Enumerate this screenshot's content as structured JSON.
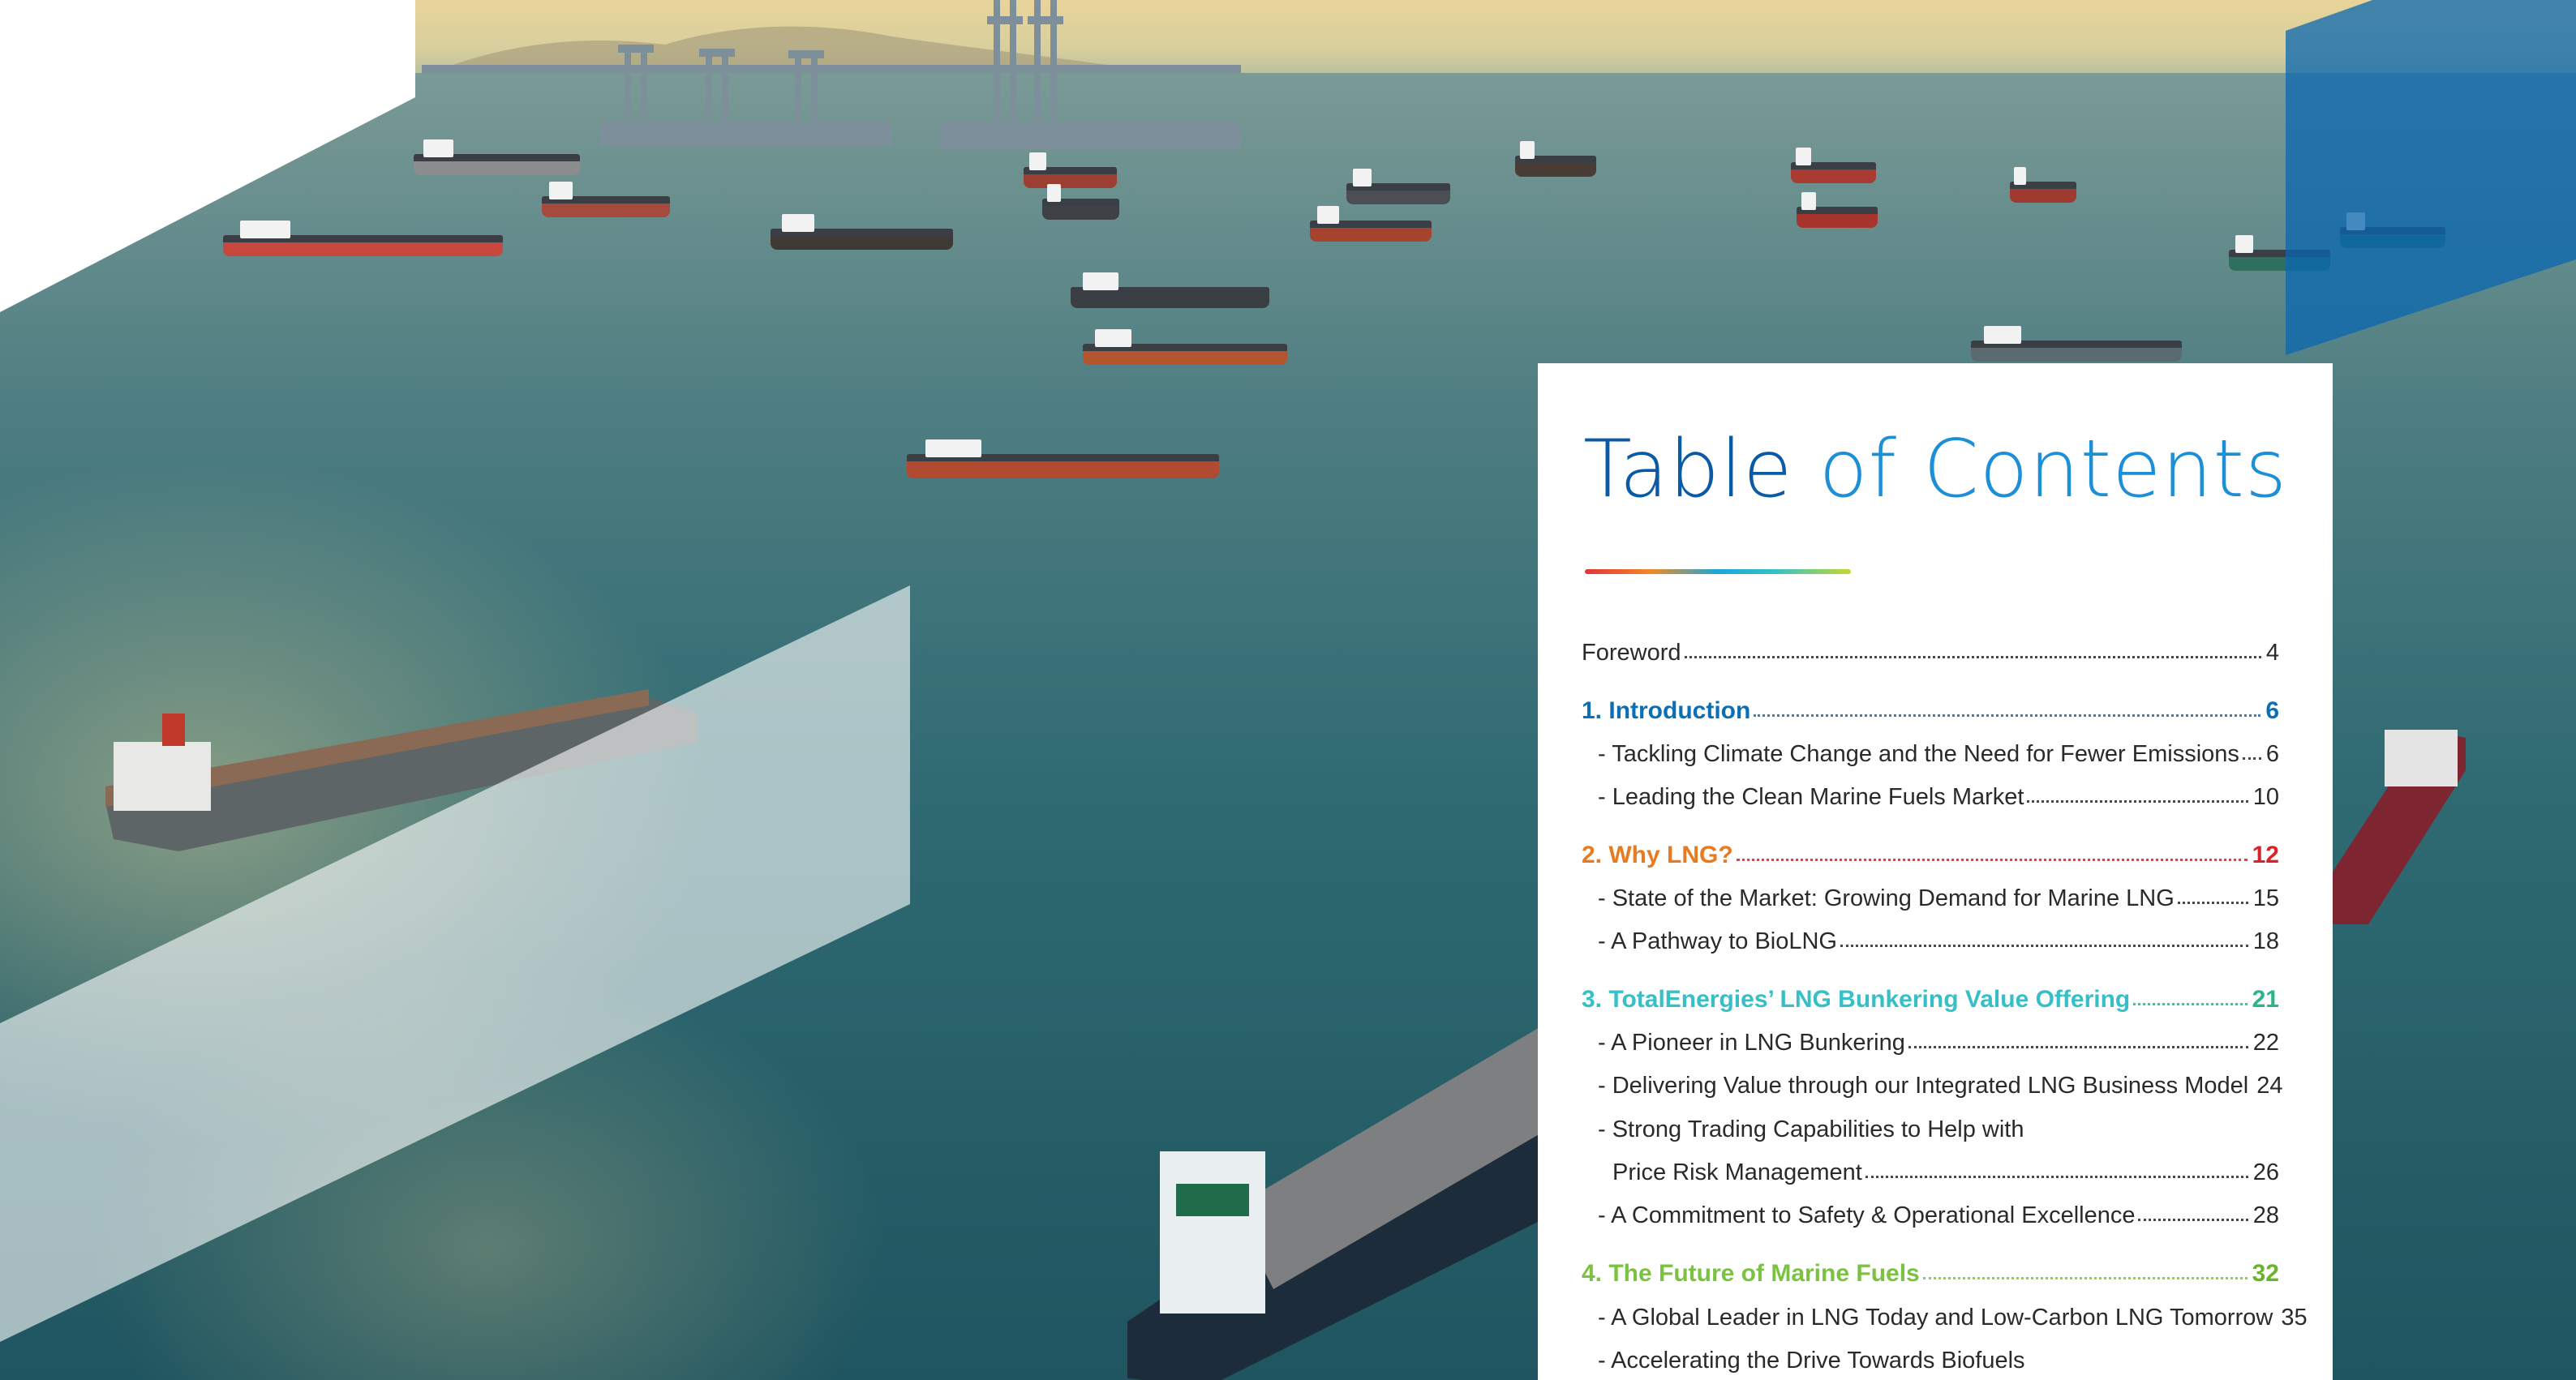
{
  "colors": {
    "title_dark_blue": "#0b5aa6",
    "title_light_blue": "#1d8fd6",
    "section1": "#0b6fb6",
    "section2": "#e87a22",
    "section2_page": "#d8232a",
    "section3": "#36bfc6",
    "section4": "#7cc242"
  },
  "title": {
    "part1": "Table",
    "part2": "of Contents"
  },
  "toc": {
    "foreword": {
      "label": "Foreword",
      "page": "4"
    },
    "s1": {
      "label": "1. Introduction",
      "page": "6",
      "items": [
        {
          "label": "- Tackling Climate Change and the Need for Fewer Emissions",
          "page": "6"
        },
        {
          "label": "- Leading the Clean Marine Fuels Market",
          "page": "10"
        }
      ]
    },
    "s2": {
      "label": "2. Why LNG?",
      "page": "12",
      "items": [
        {
          "label": "- State of the Market: Growing Demand for Marine LNG",
          "page": "15"
        },
        {
          "label": "- A Pathway to BioLNG",
          "page": "18"
        }
      ]
    },
    "s3": {
      "label": "3. TotalEnergies’ LNG Bunkering Value Offering",
      "page": "21",
      "items": [
        {
          "label": "- A Pioneer in LNG Bunkering",
          "page": "22"
        },
        {
          "label": "- Delivering Value through our Integrated LNG Business Model",
          "page": "24"
        },
        {
          "label": "- Strong Trading Capabilities to Help with",
          "page": ""
        },
        {
          "label": "Price Risk Management",
          "page": "26"
        },
        {
          "label": "- A Commitment to Safety & Operational Excellence",
          "page": "28"
        }
      ]
    },
    "s4": {
      "label": "4. The Future of Marine Fuels",
      "page": "32",
      "items": [
        {
          "label": "- A Global Leader in LNG Today and Low-Carbon LNG Tomorrow",
          "page": "35"
        },
        {
          "label": "- Accelerating the Drive Towards Biofuels",
          "page": ""
        }
      ]
    }
  }
}
